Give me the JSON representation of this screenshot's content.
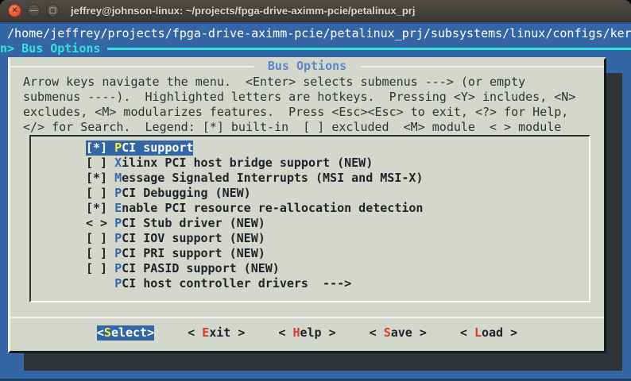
{
  "window": {
    "title": "jeffrey@johnson-linux: ~/projects/fpga-drive-aximm-pcie/petalinux_prj",
    "close_glyph": "✕",
    "minimize_glyph": "—",
    "maximize_glyph": "▢"
  },
  "terminal": {
    "path_line1": " /home/jeffrey/projects/fpga-drive-aximm-pcie/petalinux_prj/subsystems/linux/configs/ker",
    "path_line2": "n> Bus Options"
  },
  "dialog": {
    "title": " Bus Options ",
    "instructions": [
      "Arrow keys navigate the menu.  <Enter> selects submenus ---> (or empty",
      "submenus ----).  Highlighted letters are hotkeys.  Pressing <Y> includes, <N>",
      "excludes, <M> modularizes features.  Press <Esc><Esc> to exit, <?> for Help,",
      "</> for Search.  Legend: [*] built-in  [ ] excluded  <M> module  < > module"
    ],
    "menu_items": [
      {
        "marker": "[*]",
        "hotkey": "P",
        "rest": "CI support",
        "selected": true
      },
      {
        "marker": "[ ]",
        "hotkey": "X",
        "rest": "ilinx PCI host bridge support (NEW)",
        "selected": false
      },
      {
        "marker": "[*]",
        "hotkey": "M",
        "rest": "essage Signaled Interrupts (MSI and MSI-X)",
        "selected": false
      },
      {
        "marker": "[ ]",
        "hotkey": "P",
        "rest": "CI Debugging (NEW)",
        "selected": false
      },
      {
        "marker": "[*]",
        "hotkey": "E",
        "rest": "nable PCI resource re-allocation detection",
        "selected": false
      },
      {
        "marker": "< >",
        "hotkey": "P",
        "rest": "CI Stub driver (NEW)",
        "selected": false
      },
      {
        "marker": "[ ]",
        "hotkey": "P",
        "rest": "CI IOV support (NEW)",
        "selected": false
      },
      {
        "marker": "[ ]",
        "hotkey": "P",
        "rest": "CI PRI support (NEW)",
        "selected": false
      },
      {
        "marker": "[ ]",
        "hotkey": "P",
        "rest": "CI PASID support (NEW)",
        "selected": false
      },
      {
        "marker": "   ",
        "hotkey": "P",
        "rest": "CI host controller drivers  --->",
        "selected": false
      }
    ],
    "buttons": [
      {
        "pre": "<",
        "hotkey": "S",
        "rest": "elect>",
        "selected": true
      },
      {
        "pre": "< ",
        "hotkey": "E",
        "rest": "xit >",
        "selected": false
      },
      {
        "pre": "< ",
        "hotkey": "H",
        "rest": "elp >",
        "selected": false
      },
      {
        "pre": "< ",
        "hotkey": "S",
        "rest": "ave >",
        "selected": false
      },
      {
        "pre": "< ",
        "hotkey": "L",
        "rest": "oad >",
        "selected": false
      }
    ]
  },
  "colors": {
    "terminal_blue": "#3465a4",
    "cyan_accent": "#34e2e2",
    "dialog_bg": "#d4d8cc",
    "shadow": "#2e3436",
    "hotkey_red": "#dd3826",
    "hotkey_yellow": "#fce94f",
    "hotkey_blue": "#3569ae",
    "dialog_title_blue": "#5c87c9"
  }
}
